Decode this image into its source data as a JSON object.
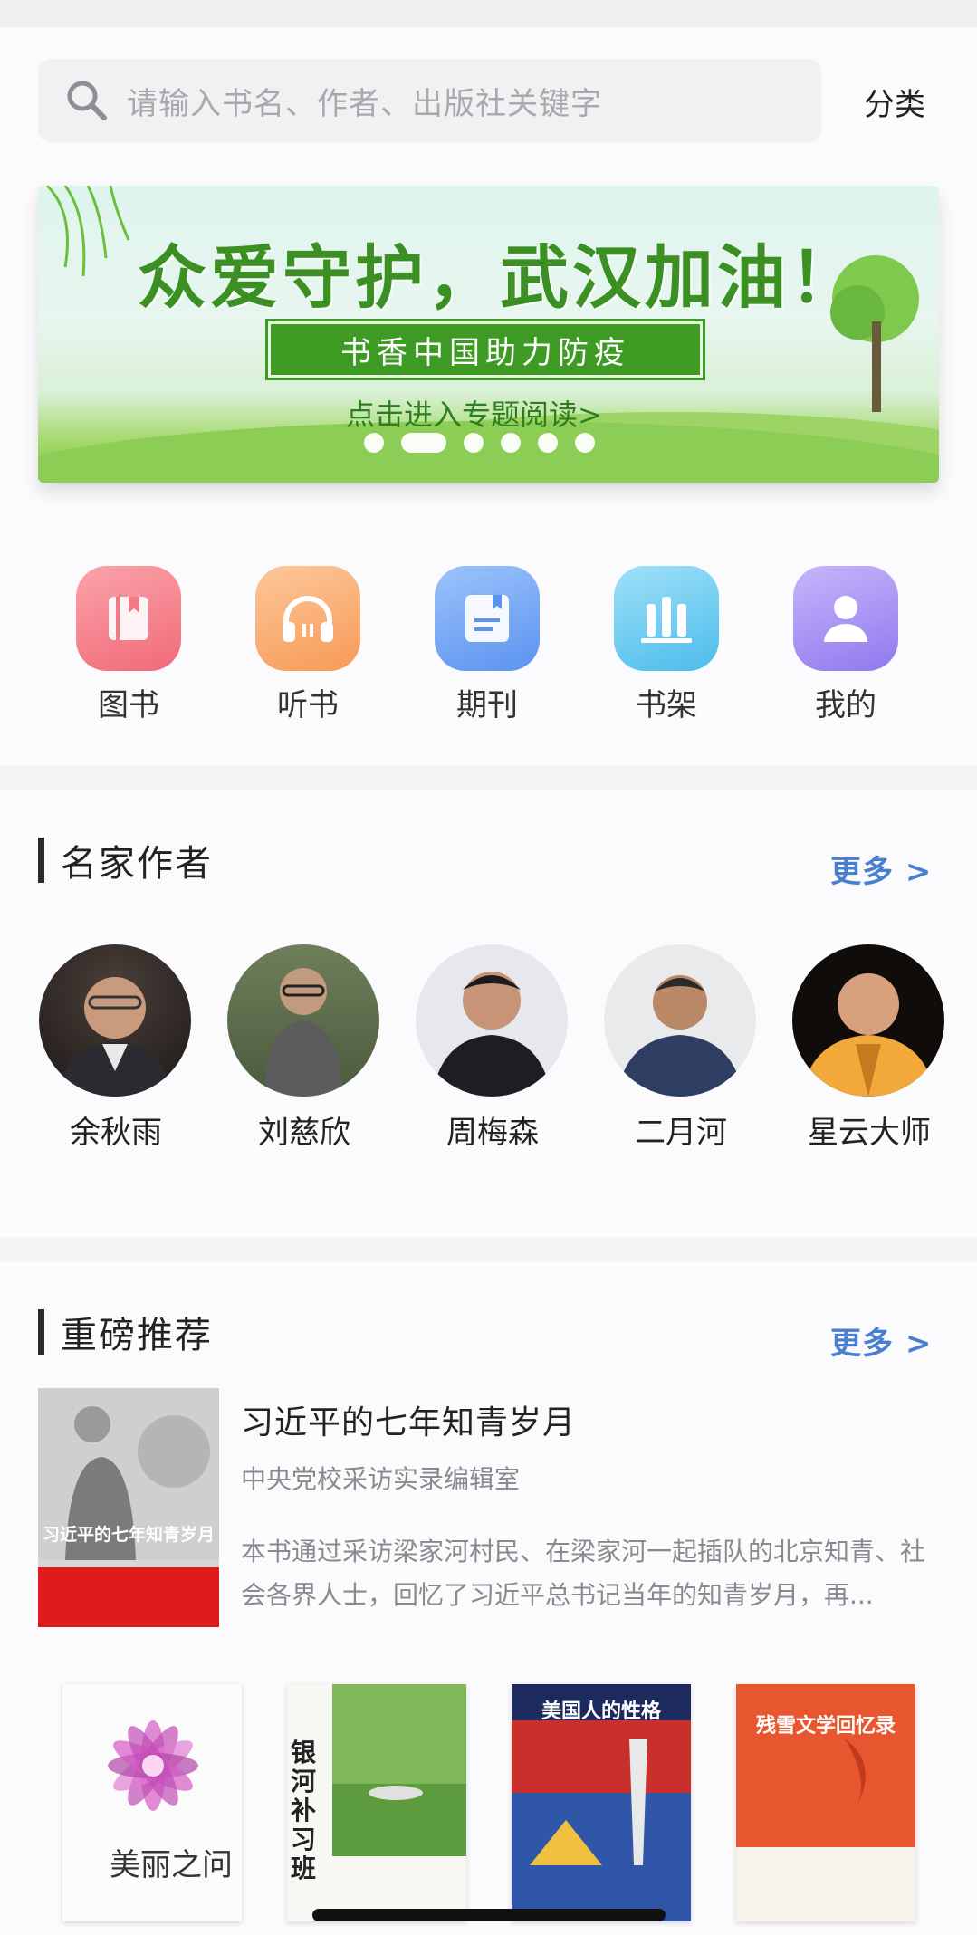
{
  "search": {
    "placeholder": "请输入书名、作者、出版社关键字",
    "category_label": "分类"
  },
  "banner": {
    "headline": "众爱守护，武汉加油！",
    "tag": "书香中国助力防疫",
    "cta": "点击进入专题阅读>",
    "slide_count": 6,
    "active_slide": 2
  },
  "quicknav": [
    {
      "label": "图书",
      "icon": "book-icon",
      "color": "#f07a86"
    },
    {
      "label": "听书",
      "icon": "headphones-icon",
      "color": "#f9a86a"
    },
    {
      "label": "期刊",
      "icon": "journal-icon",
      "color": "#6aa0f3"
    },
    {
      "label": "书架",
      "icon": "bookshelf-icon",
      "color": "#5cc4ef"
    },
    {
      "label": "我的",
      "icon": "user-icon",
      "color": "#a08af0"
    }
  ],
  "authors_section": {
    "title": "名家作者",
    "more": "更多 >",
    "authors": [
      {
        "name": "余秋雨"
      },
      {
        "name": "刘慈欣"
      },
      {
        "name": "周梅森"
      },
      {
        "name": "二月河"
      },
      {
        "name": "星云大师"
      }
    ]
  },
  "featured_section": {
    "title": "重磅推荐",
    "more": "更多 >",
    "book": {
      "title": "习近平的七年知青岁月",
      "author": "中央党校采访实录编辑室",
      "description": "本书通过采访梁家河村民、在梁家河一起插队的北京知青、社会各界人士，回忆了习近平总书记当年的知青岁月，再...",
      "cover_title": "习近平的七年知青岁月"
    },
    "books": [
      {
        "cover_title": "美丽之问"
      },
      {
        "cover_title": "银河补习班"
      },
      {
        "cover_title": "美国人的性格"
      },
      {
        "cover_title": "残雪文学回忆录"
      }
    ]
  },
  "colors": {
    "accent_blue": "#4a7fd0",
    "banner_green": "#3d9a22"
  }
}
